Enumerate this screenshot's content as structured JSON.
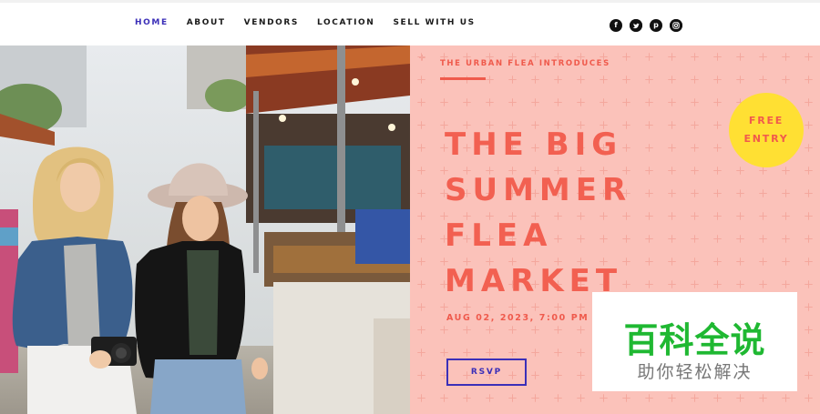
{
  "nav": {
    "items": [
      {
        "label": "HOME",
        "active": true
      },
      {
        "label": "ABOUT",
        "active": false
      },
      {
        "label": "VENDORS",
        "active": false
      },
      {
        "label": "LOCATION",
        "active": false
      },
      {
        "label": "SELL WITH US",
        "active": false
      }
    ]
  },
  "social": [
    {
      "icon": "facebook-icon",
      "glyph": "f"
    },
    {
      "icon": "twitter-icon",
      "glyph": "t"
    },
    {
      "icon": "pinterest-icon",
      "glyph": "p"
    },
    {
      "icon": "instagram-icon",
      "glyph": "◎"
    }
  ],
  "event": {
    "intro": "THE URBAN FLEA INTRODUCES",
    "title_lines": [
      "THE BIG",
      "SUMMER",
      "FLEA",
      "MARKET"
    ],
    "date": "AUG 02, 2023, 7:00 PM",
    "rsvp_label": "RSVP",
    "badge_lines": [
      "FREE",
      "ENTRY"
    ]
  },
  "watermark": {
    "title": "百科全说",
    "subtitle": "助你轻松解决"
  },
  "colors": {
    "accent": "#3b2fb8",
    "coral": "#f26051",
    "panel": "#fbc2ba",
    "badge": "#ffe033",
    "watermark_green": "#1fb832"
  }
}
